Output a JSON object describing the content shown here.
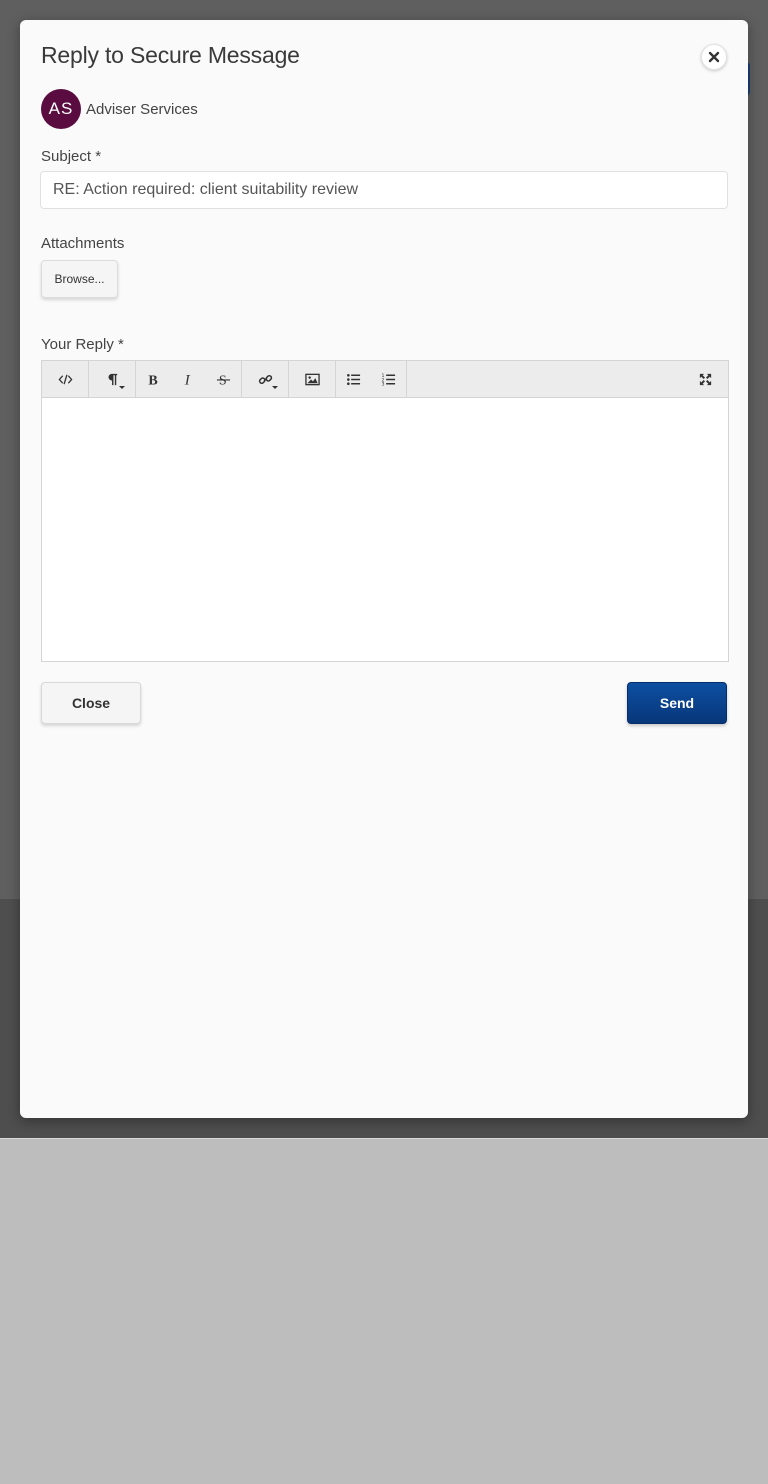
{
  "modal": {
    "title": "Reply to Secure Message",
    "sender": {
      "initials": "AS",
      "name": "Adviser Services",
      "avatar_color": "#5a0c40"
    },
    "subject": {
      "label": "Subject *",
      "value": "RE: Action required: client suitability review"
    },
    "attachments": {
      "label": "Attachments",
      "browse_label": "Browse..."
    },
    "reply": {
      "label": "Your Reply *",
      "value": ""
    },
    "editor_toolbar": [
      {
        "name": "code-view-icon"
      },
      {
        "name": "paragraph-style-icon",
        "dropdown": true
      },
      {
        "name": "bold-icon"
      },
      {
        "name": "italic-icon"
      },
      {
        "name": "strikethrough-icon"
      },
      {
        "name": "link-icon",
        "dropdown": true
      },
      {
        "name": "image-icon"
      },
      {
        "name": "bullet-list-icon"
      },
      {
        "name": "numbered-list-icon"
      },
      {
        "name": "fullscreen-icon"
      }
    ],
    "buttons": {
      "close_label": "Close",
      "send_label": "Send"
    },
    "colors": {
      "send_button": "#0b4596",
      "avatar": "#5a0c40"
    }
  }
}
